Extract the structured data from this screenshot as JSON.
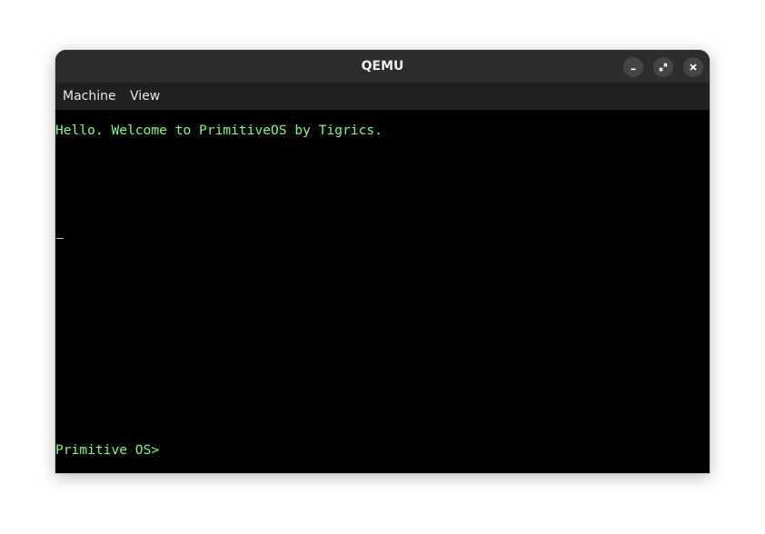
{
  "window": {
    "title": "QEMU",
    "controls": {
      "minimize_icon": "minimize-icon",
      "maximize_icon": "maximize-icon",
      "close_icon": "close-icon"
    }
  },
  "menubar": {
    "items": [
      {
        "label": "Machine"
      },
      {
        "label": "View"
      }
    ]
  },
  "terminal": {
    "welcome": "Hello. Welcome to PrimitiveOS by Tigrics.",
    "prompt": "Primitive OS>",
    "text_color": "#7cfc7c",
    "background": "#000000"
  },
  "colors": {
    "titlebar": "#2d2d2d",
    "menubar": "#202020",
    "button": "#454545"
  }
}
